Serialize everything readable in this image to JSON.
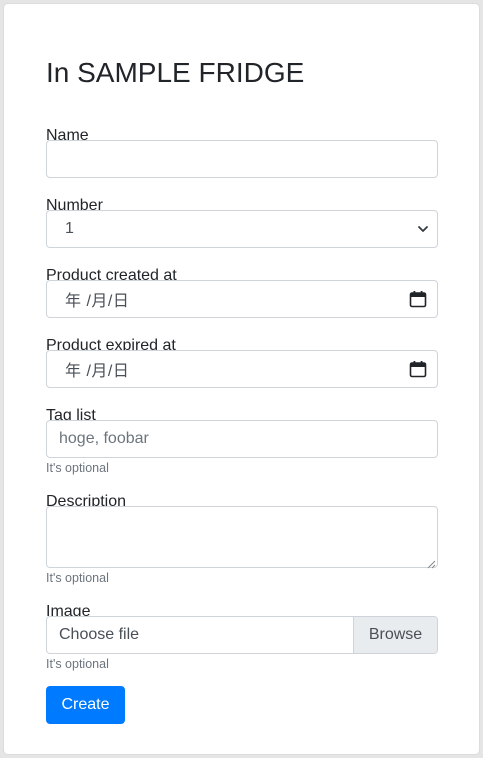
{
  "form": {
    "title": "In SAMPLE FRIDGE",
    "name": {
      "label": "Name",
      "value": ""
    },
    "number": {
      "label": "Number",
      "value": "1"
    },
    "created_at": {
      "label": "Product created at",
      "value": "年 /月/日"
    },
    "expired_at": {
      "label": "Product expired at",
      "value": "年 /月/日"
    },
    "tag_list": {
      "label": "Tag list",
      "placeholder": "hoge, foobar",
      "help": "It's optional"
    },
    "description": {
      "label": "Description",
      "help": "It's optional"
    },
    "image": {
      "label": "Image",
      "file_label": "Choose file",
      "browse_label": "Browse",
      "help": "It's optional"
    },
    "submit_label": "Create"
  },
  "colors": {
    "primary": "#007bff",
    "border": "#ced4da",
    "muted": "#6c757d",
    "browse_bg": "#e9ecef",
    "page_bg": "#e5e5e5"
  },
  "icons": {
    "select": "chevron-down-icon",
    "date": "calendar-icon"
  }
}
